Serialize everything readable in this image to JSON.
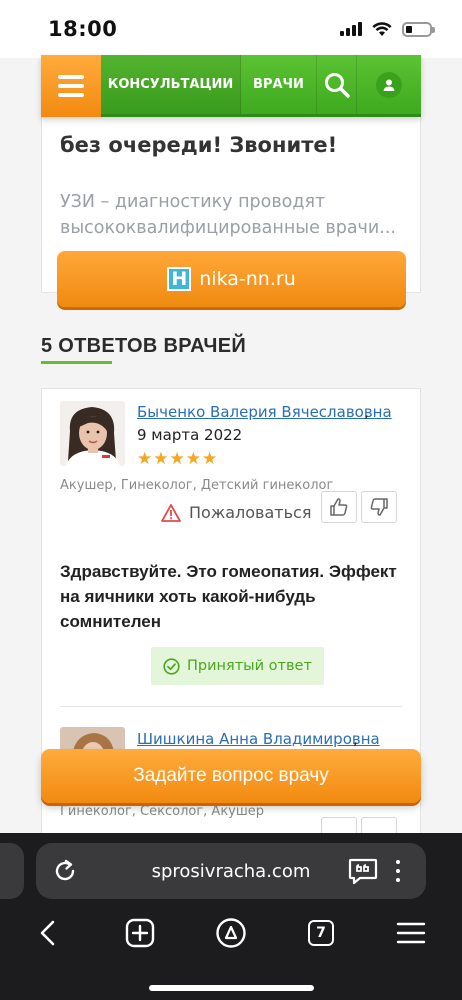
{
  "status_bar": {
    "time": "18:00"
  },
  "header": {
    "menu_icon": "hamburger-menu-icon",
    "nav_consultations": "КОНСУЛЬТАЦИИ",
    "nav_doctors": "ВРАЧИ",
    "search_icon": "search-icon",
    "user_icon": "user-profile-icon"
  },
  "ad": {
    "headline": "без очереди! Звоните!",
    "description": "УЗИ – диагностику проводят высококвалифицированные врачи...",
    "button_logo": "H",
    "button_label": "nika-nn.ru"
  },
  "answers_section": {
    "title": "5 ОТВЕТОВ ВРАЧЕЙ"
  },
  "answers": [
    {
      "doctor_name": "Быченко Валерия Вячеславовна",
      "date": "9 марта 2022",
      "rating_stars": 5,
      "specialties": "Акушер, Гинеколог, Детский гинеколог",
      "report_label": "Пожаловаться",
      "text": "Здравствуйте. Это гомеопатия. Эффект на яичники хоть какой-нибудь сомнителен",
      "accepted_label": "Принятый ответ"
    },
    {
      "doctor_name": "Шишкина Анна Владимировна",
      "specialties": "Гинеколог, Сексолог, Акушер"
    }
  ],
  "comma": ",",
  "cta": {
    "label": "Задайте вопрос врачу"
  },
  "browser": {
    "url": "sprosivracha.com",
    "tab_count": "7"
  },
  "colors": {
    "orange": "#f28a10",
    "green": "#4cb82a",
    "link_blue": "#2a6eb5",
    "star": "#f5a623"
  }
}
